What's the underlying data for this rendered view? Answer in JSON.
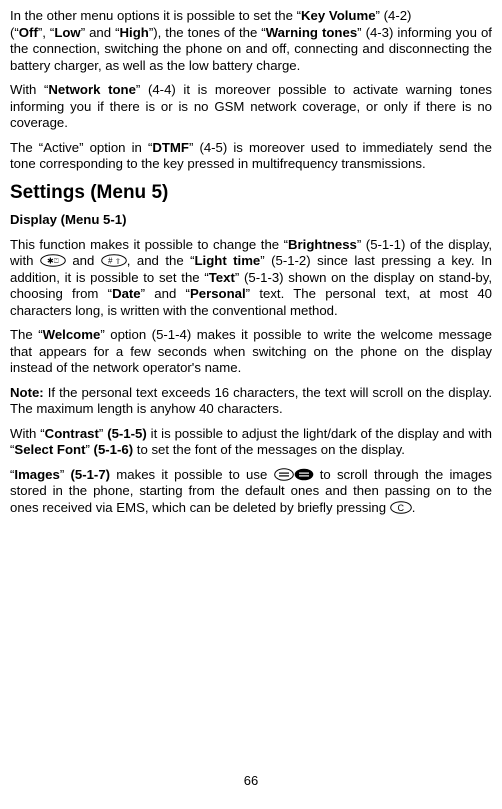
{
  "page_number": "66",
  "p1a": "In the other menu options it is possible to set the “",
  "p1b": "Key Volume",
  "p1c": "” (4-2)",
  "p1d": "(“",
  "p1e": "Off",
  "p1f": "”, “",
  "p1g": "Low",
  "p1h": "” and “",
  "p1i": "High",
  "p1j": "”), the tones of the “",
  "p1k": "Warning tones",
  "p1l": "” (4-3) informing you of the connection, switching the phone on and off, connecting and disconnecting the battery charger, as well as the low battery charge.",
  "p2a": "With “",
  "p2b": "Network tone",
  "p2c": "” (4-4) it is moreover possible to activate warning tones informing you if there is or is no GSM network coverage, or only if there is no coverage.",
  "p3a": "The “Active” option in “",
  "p3b": "DTMF",
  "p3c": "” (4-5) is moreover used to immediately send the tone corresponding to the key pressed in multifrequency transmissions.",
  "h_settings": "Settings (Menu 5)",
  "h_display": "Display (Menu 5-1)",
  "p4a": "This function makes it possible to change the “",
  "p4b": "Brightness",
  "p4c": "” (5-1-1) of the display, with ",
  "p4d": " and ",
  "p4e": ", and the “",
  "p4f": "Light time",
  "p4g": "” (5-1-2) since last pressing a key. In addition, it is possible to set the “",
  "p4h": "Text",
  "p4i": "” (5-1-3) shown on the display on stand-by, choosing from “",
  "p4j": "Date",
  "p4k": "” and “",
  "p4l": "Personal",
  "p4m": "” text. The personal text, at most 40 characters long, is written with the conventional method.",
  "p5a": "The “",
  "p5b": "Welcome",
  "p5c": "” option (5-1-4) makes it possible to write the welcome message that appears for a few seconds when switching on the phone on the display instead of the network operator's name.",
  "p6a": "Note:",
  "p6b": " If the personal text exceeds 16 characters, the text will scroll on the display. The maximum length is anyhow 40 characters.",
  "p7a": "With “",
  "p7b": "Contrast",
  "p7c": "” ",
  "p7d": "(5-1-5)",
  "p7e": " it is possible to adjust the light/dark of the display and with “",
  "p7f": "Select Font",
  "p7g": "” ",
  "p7h": "(5-1-6)",
  "p7i": " to set the font of the messages on the display.",
  "p8a": "“",
  "p8b": "Images",
  "p8c": "” ",
  "p8d": "(5-1-7)",
  "p8e": " makes it possible to use ",
  "p8f": " to scroll through the images stored in the phone, starting from the default ones and then passing on to the ones received via EMS, which can be deleted by briefly pressing ",
  "p8g": "."
}
